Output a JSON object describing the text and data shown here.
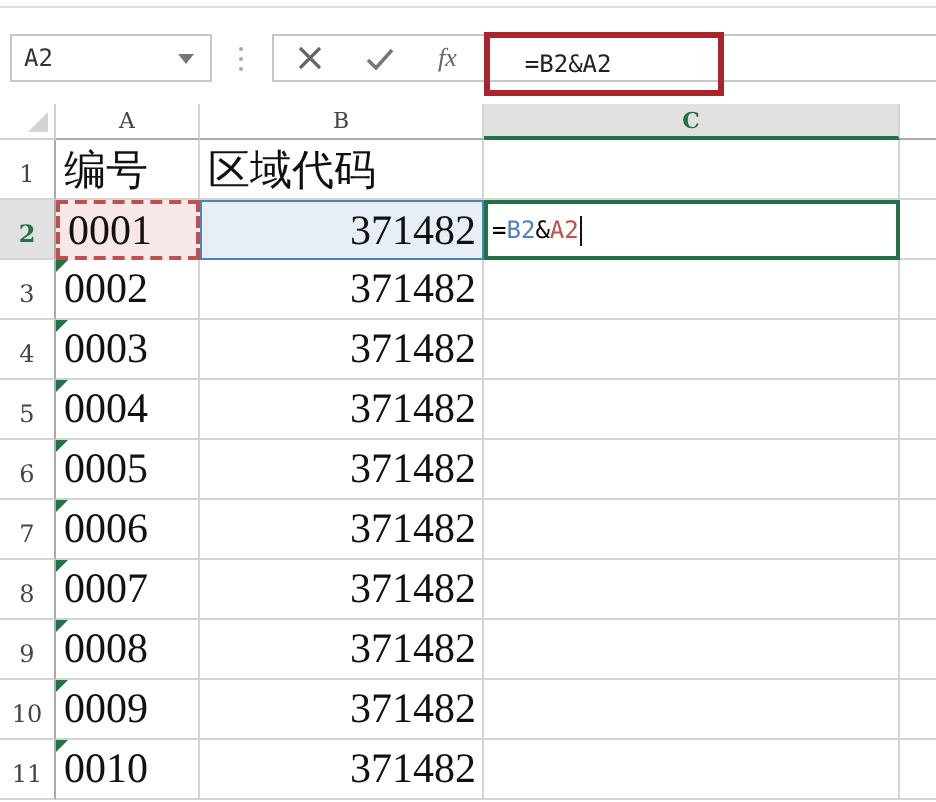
{
  "name_box": {
    "value": "A2"
  },
  "formula_bar": {
    "function_label": "fx",
    "value": "=B2&A2",
    "highlighted": true
  },
  "columns": [
    {
      "label": "A",
      "selected": false
    },
    {
      "label": "B",
      "selected": false
    },
    {
      "label": "C",
      "selected": true
    }
  ],
  "rows": [
    {
      "label": "1",
      "selected": false,
      "cells": [
        {
          "text": "编号",
          "flag": false
        },
        {
          "text": "区域代码"
        }
      ]
    },
    {
      "label": "2",
      "selected": true,
      "cells": [
        {
          "text": "0001",
          "flag": false,
          "color": "#c0504d"
        },
        {
          "text": "371482",
          "color": "#4f81bd"
        },
        {
          "kind": "edit",
          "segments": [
            {
              "text": "=",
              "color": "#000000"
            },
            {
              "text": "B2",
              "color": "#4f81bd"
            },
            {
              "text": "&",
              "color": "#000000"
            },
            {
              "text": "A2",
              "color": "#c0504d"
            }
          ]
        }
      ]
    },
    {
      "label": "3",
      "selected": false,
      "cells": [
        {
          "text": "0002",
          "flag": true
        },
        {
          "text": "371482"
        }
      ]
    },
    {
      "label": "4",
      "selected": false,
      "cells": [
        {
          "text": "0003",
          "flag": true
        },
        {
          "text": "371482"
        }
      ]
    },
    {
      "label": "5",
      "selected": false,
      "cells": [
        {
          "text": "0004",
          "flag": true
        },
        {
          "text": "371482"
        }
      ]
    },
    {
      "label": "6",
      "selected": false,
      "cells": [
        {
          "text": "0005",
          "flag": true
        },
        {
          "text": "371482"
        }
      ]
    },
    {
      "label": "7",
      "selected": false,
      "cells": [
        {
          "text": "0006",
          "flag": true
        },
        {
          "text": "371482"
        }
      ]
    },
    {
      "label": "8",
      "selected": false,
      "cells": [
        {
          "text": "0007",
          "flag": true
        },
        {
          "text": "371482"
        }
      ]
    },
    {
      "label": "9",
      "selected": false,
      "cells": [
        {
          "text": "0008",
          "flag": true
        },
        {
          "text": "371482"
        }
      ]
    },
    {
      "label": "10",
      "selected": false,
      "cells": [
        {
          "text": "0009",
          "flag": true
        },
        {
          "text": "371482"
        }
      ]
    },
    {
      "label": "11",
      "selected": false,
      "cells": [
        {
          "text": "0010",
          "flag": true
        },
        {
          "text": "371482"
        }
      ]
    }
  ]
}
